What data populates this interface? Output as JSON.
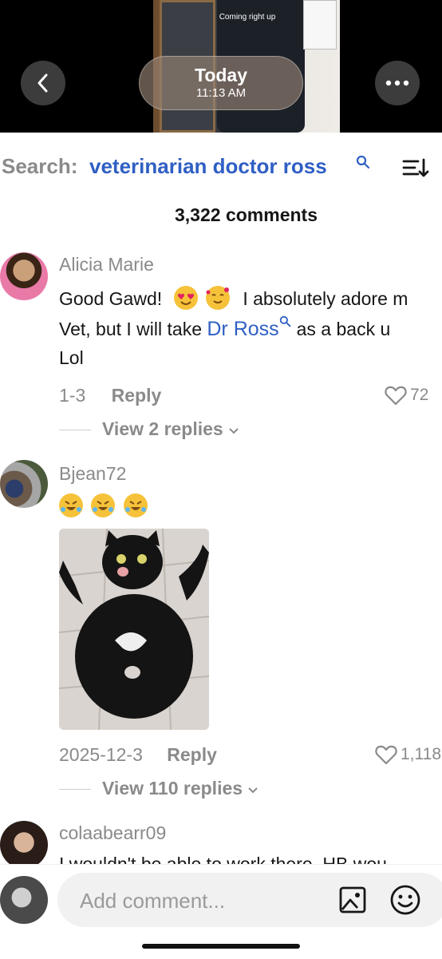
{
  "video": {
    "banner": "Coming right up",
    "date_label": "Today",
    "time_label": "11:13 AM"
  },
  "icons": {
    "back": "chevron-left-icon",
    "more": "ellipsis-icon",
    "search": "search-icon",
    "sort": "sort-icon",
    "heart": "heart-icon",
    "chevron": "chevron-down-icon",
    "image": "image-icon",
    "emoji": "emoji-icon"
  },
  "search": {
    "prefix": "Search:",
    "query": "veterinarian doctor ross"
  },
  "comments_header": {
    "count": "3,322 comments"
  },
  "comments": [
    {
      "username": "Alicia Marie",
      "text_parts": [
        "Good Gawd!",
        "I absolutely adore m",
        "Vet, but I will take",
        "Dr Ross",
        "as a back u",
        "Lol"
      ],
      "date": "1-3",
      "reply_label": "Reply",
      "likes": "72",
      "view_replies": "View 2 replies"
    },
    {
      "username": "Bjean72",
      "date": "2025-12-3",
      "reply_label": "Reply",
      "likes": "1,118",
      "view_replies": "View 110 replies"
    },
    {
      "username": "colaabearr09",
      "text": "I wouldn't be able to work there. HB wou"
    }
  ],
  "composer": {
    "placeholder": "Add comment..."
  },
  "colors": {
    "link_blue": "#2f5fc4",
    "muted_gray": "#8a8a8a",
    "text": "#161616"
  }
}
